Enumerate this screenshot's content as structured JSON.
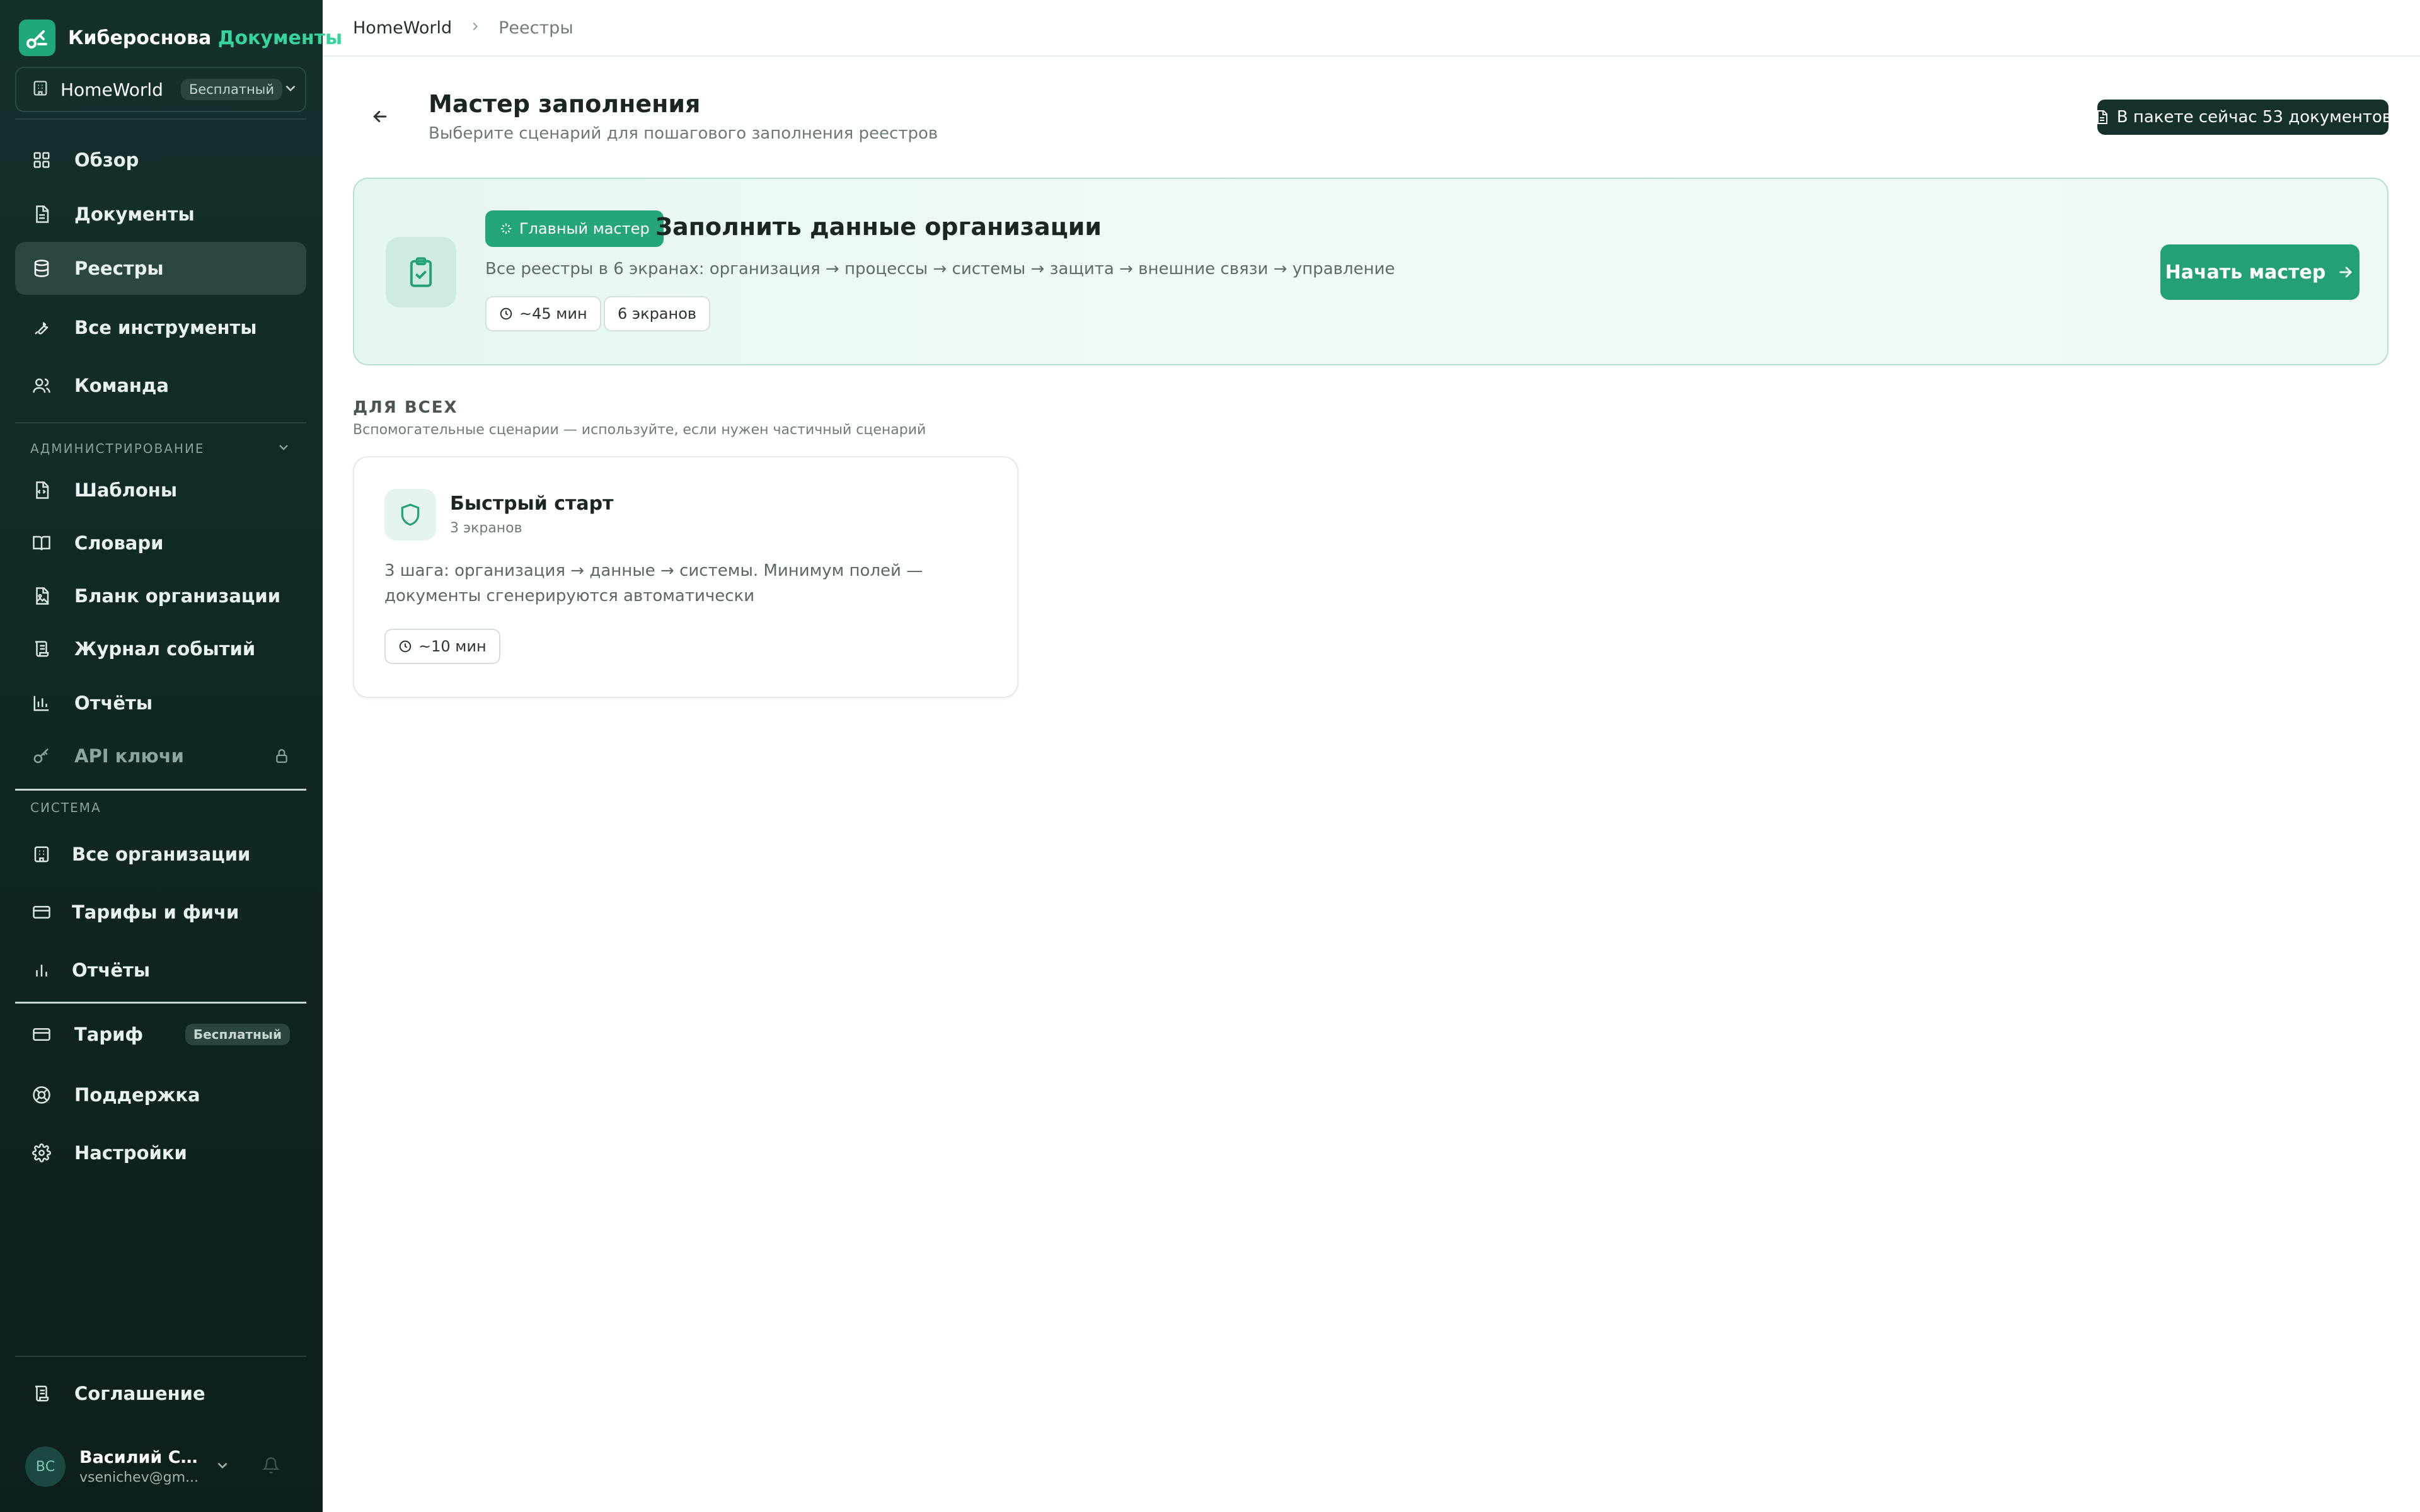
{
  "brand": {
    "name": "Кибероснова",
    "accent": "Документы"
  },
  "org": {
    "name": "HomeWorld",
    "plan_badge": "Бесплатный"
  },
  "nav_main": [
    {
      "label": "Обзор",
      "icon": "grid-icon"
    },
    {
      "label": "Документы",
      "icon": "file-icon"
    },
    {
      "label": "Реестры",
      "icon": "database-icon"
    },
    {
      "label": "Все инструменты",
      "icon": "wrench-icon"
    },
    {
      "label": "Команда",
      "icon": "users-icon"
    }
  ],
  "admin": {
    "section_label": "АДМИНИСТРИРОВАНИЕ",
    "items": [
      {
        "label": "Шаблоны",
        "icon": "file-code-icon"
      },
      {
        "label": "Словари",
        "icon": "book-icon"
      },
      {
        "label": "Бланк организации",
        "icon": "file-image-icon"
      },
      {
        "label": "Журнал событий",
        "icon": "scroll-icon"
      },
      {
        "label": "Отчёты",
        "icon": "bar-chart-icon"
      },
      {
        "label": "API ключи",
        "icon": "key-icon"
      }
    ]
  },
  "system": {
    "section_label": "СИСТЕМА",
    "items": [
      {
        "label": "Все организации",
        "icon": "building-icon"
      },
      {
        "label": "Тарифы и фичи",
        "icon": "credit-card-icon"
      },
      {
        "label": "Отчёты",
        "icon": "bar-chart-icon"
      }
    ]
  },
  "nav_bottom": [
    {
      "label": "Тариф",
      "icon": "credit-card-icon",
      "badge": "Бесплатный"
    },
    {
      "label": "Поддержка",
      "icon": "lifebuoy-icon"
    },
    {
      "label": "Настройки",
      "icon": "gear-icon"
    }
  ],
  "agreement": {
    "label": "Соглашение"
  },
  "user": {
    "initials": "ВС",
    "name": "Василий Сен...",
    "email": "vsenichev@gm..."
  },
  "breadcrumb": {
    "root": "HomeWorld",
    "current": "Реестры"
  },
  "page": {
    "title": "Мастер заполнения",
    "subtitle": "Выберите сценарий для пошагового заполнения реестров",
    "pack_badge": "В пакете сейчас 53 документов"
  },
  "hero": {
    "tag": "Главный мастер",
    "title": "Заполнить данные организации",
    "description": "Все реестры в 6 экранах: организация → процессы → системы → защита → внешние связи → управление",
    "duration": "~45 мин",
    "screens": "6 экранов",
    "button": "Начать мастер"
  },
  "for_all": {
    "title": "ДЛЯ ВСЕХ",
    "subtitle": "Вспомогательные сценарии — используйте, если нужен частичный сценарий"
  },
  "quick_start": {
    "title": "Быстрый старт",
    "screens": "3 экранов",
    "description": "3 шага: организация → данные → системы. Минимум полей — документы сгенерируются автоматически",
    "duration": "~10 мин"
  },
  "colors": {
    "sidebar_bg": "#14302d",
    "accent": "#23a174",
    "accent_light": "#36d39a",
    "hero_border": "#b6e0d2"
  }
}
